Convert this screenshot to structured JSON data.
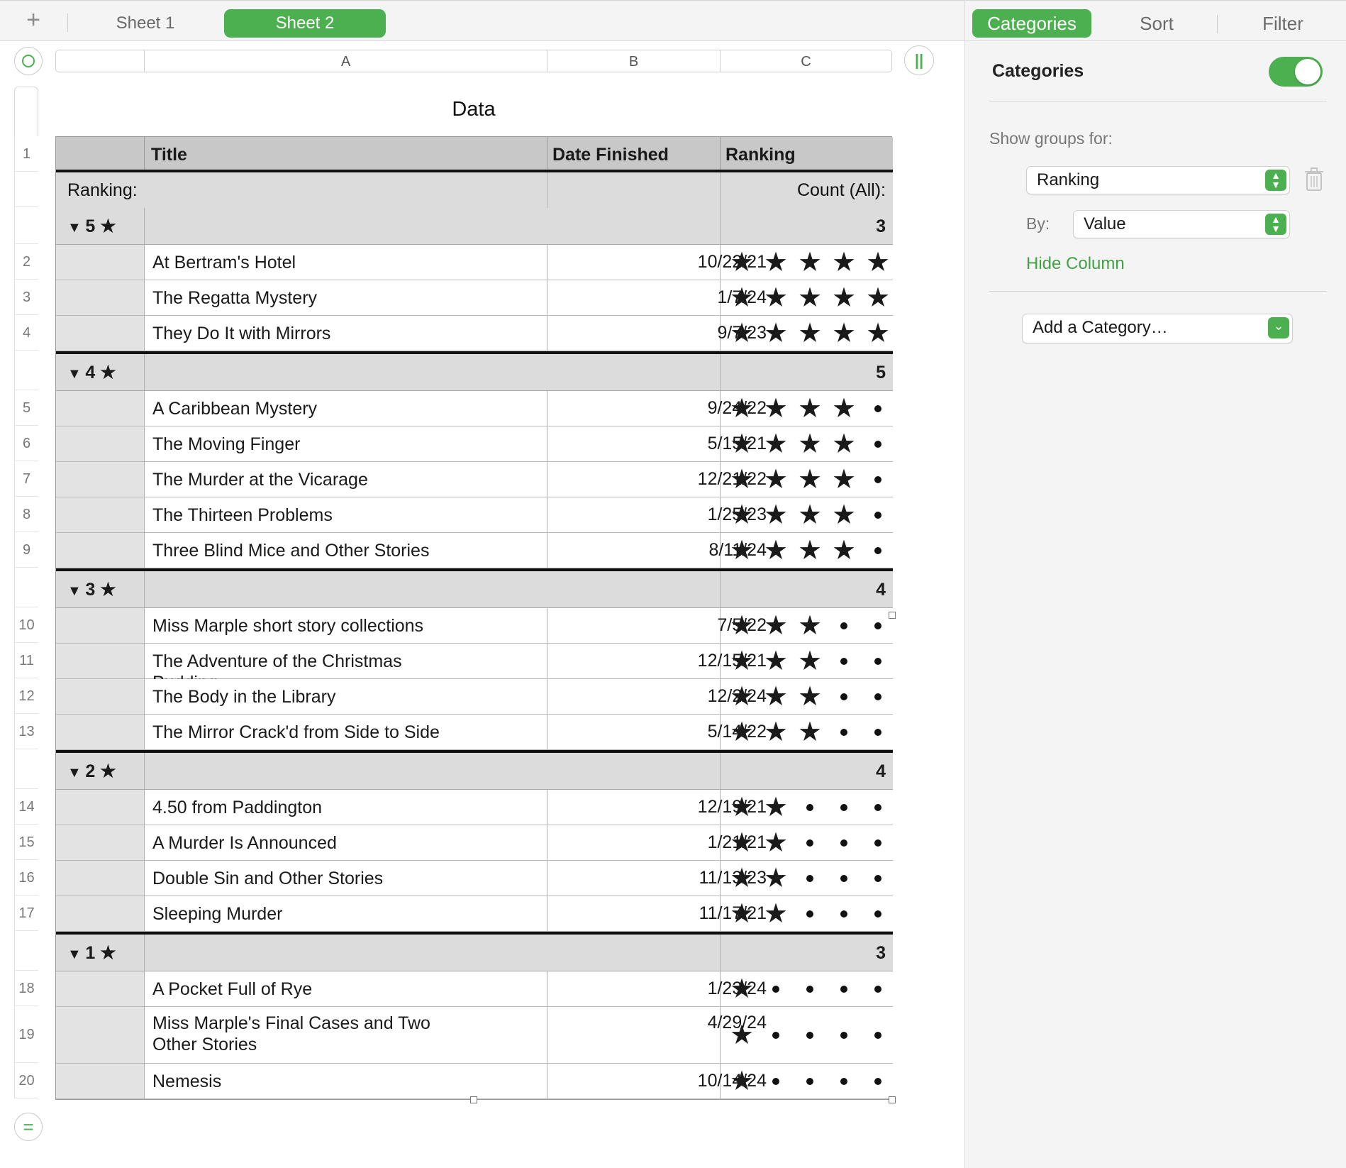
{
  "tabs": {
    "add_label": "+",
    "sheets": [
      "Sheet 1",
      "Sheet 2"
    ],
    "active": "Sheet 2"
  },
  "columns": [
    "A",
    "B",
    "C"
  ],
  "table": {
    "title": "Data",
    "headers": {
      "title": "Title",
      "date": "Date Finished",
      "ranking": "Ranking"
    },
    "category_label": "Ranking:",
    "count_label": "Count (All):",
    "groups": [
      {
        "label": "5 ★",
        "count": "3",
        "rows": [
          {
            "num": "2",
            "title": "At Bertram's Hotel",
            "date": "10/22/21",
            "stars": 5
          },
          {
            "num": "3",
            "title": "The Regatta Mystery",
            "date": "1/7/24",
            "stars": 5
          },
          {
            "num": "4",
            "title": "They Do It with Mirrors",
            "date": "9/7/23",
            "stars": 5
          }
        ]
      },
      {
        "label": "4 ★",
        "count": "5",
        "rows": [
          {
            "num": "5",
            "title": "A Caribbean Mystery",
            "date": "9/24/22",
            "stars": 4
          },
          {
            "num": "6",
            "title": "The Moving Finger",
            "date": "5/15/21",
            "stars": 4
          },
          {
            "num": "7",
            "title": "The Murder at the Vicarage",
            "date": "12/21/22",
            "stars": 4
          },
          {
            "num": "8",
            "title": "The Thirteen Problems",
            "date": "1/25/23",
            "stars": 4
          },
          {
            "num": "9",
            "title": "Three Blind Mice and Other Stories",
            "date": "8/11/24",
            "stars": 4
          }
        ]
      },
      {
        "label": "3 ★",
        "count": "4",
        "rows": [
          {
            "num": "10",
            "title": "Miss Marple short story collections",
            "date": "7/5/22",
            "stars": 3
          },
          {
            "num": "11",
            "title": "The Adventure of the Christmas Pudding",
            "date": "12/15/21",
            "stars": 3
          },
          {
            "num": "12",
            "title": "The Body in the Library",
            "date": "12/2/24",
            "stars": 3
          },
          {
            "num": "13",
            "title": "The Mirror Crack'd from Side to Side",
            "date": "5/14/22",
            "stars": 3
          }
        ]
      },
      {
        "label": "2 ★",
        "count": "4",
        "rows": [
          {
            "num": "14",
            "title": "4.50 from Paddington",
            "date": "12/19/21",
            "stars": 2
          },
          {
            "num": "15",
            "title": "A Murder Is Announced",
            "date": "1/21/21",
            "stars": 2
          },
          {
            "num": "16",
            "title": "Double Sin and Other Stories",
            "date": "11/13/23",
            "stars": 2
          },
          {
            "num": "17",
            "title": "Sleeping Murder",
            "date": "11/17/21",
            "stars": 2
          }
        ]
      },
      {
        "label": "1 ★",
        "count": "3",
        "rows": [
          {
            "num": "18",
            "title": "A Pocket Full of Rye",
            "date": "1/23/24",
            "stars": 1
          },
          {
            "num": "19",
            "title": "Miss Marple's Final Cases and Two Other Stories",
            "date": "4/29/24",
            "stars": 1
          },
          {
            "num": "20",
            "title": "Nemesis",
            "date": "10/14/24",
            "stars": 1
          }
        ]
      }
    ],
    "header_row_num": "1"
  },
  "inspector": {
    "tabs": [
      "Categories",
      "Sort",
      "Filter"
    ],
    "active_tab": "Categories",
    "categories_heading": "Categories",
    "categories_enabled": true,
    "show_groups_label": "Show groups for:",
    "group_column": "Ranking",
    "by_label": "By:",
    "by_value": "Value",
    "hide_column_label": "Hide Column",
    "add_category_label": "Add a Category…"
  },
  "colors": {
    "accent": "#4caf50",
    "header_bg": "#c8c8c8",
    "group_bg": "#dcdcdc"
  }
}
